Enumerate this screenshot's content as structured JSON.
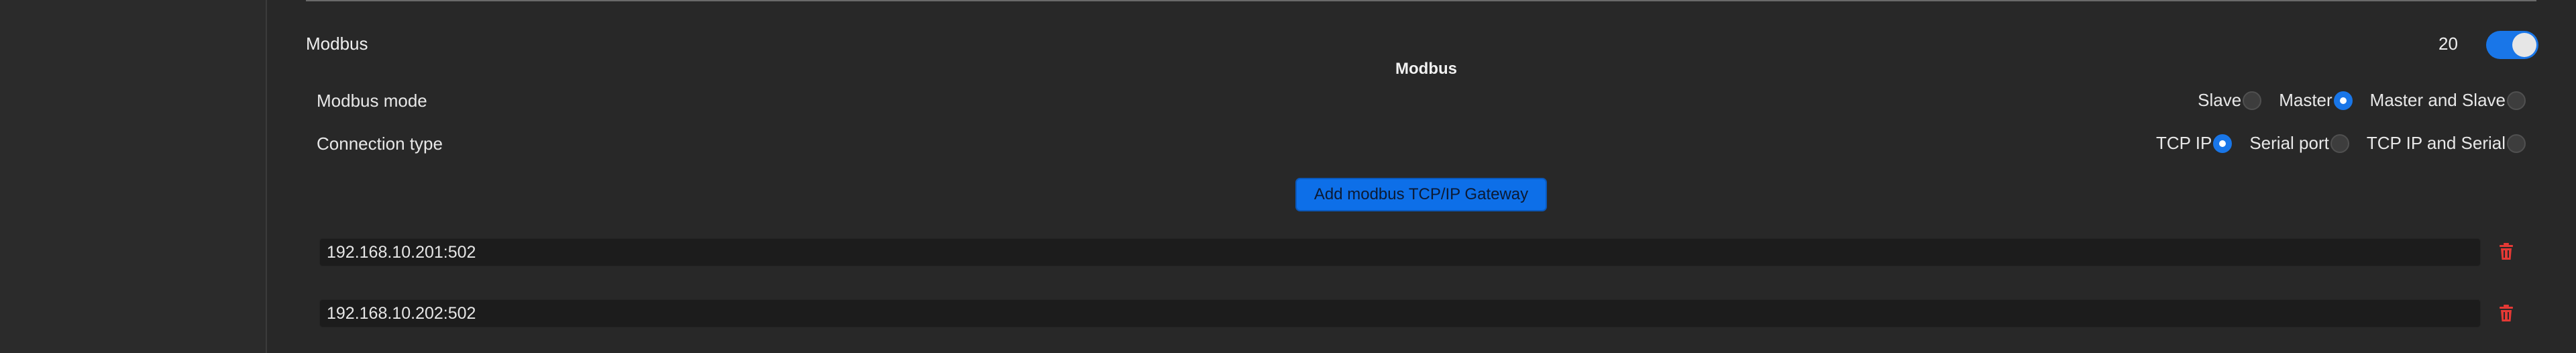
{
  "section": {
    "title": "Modbus",
    "count": "20",
    "enabled": true,
    "subheading": "Modbus"
  },
  "modbus_mode": {
    "label": "Modbus mode",
    "options": [
      "Slave",
      "Master",
      "Master and Slave"
    ],
    "selected": "Master"
  },
  "connection_type": {
    "label": "Connection type",
    "options": [
      "TCP IP",
      "Serial port",
      "TCP IP and Serial"
    ],
    "selected": "TCP IP"
  },
  "add_gateway_label": "Add modbus TCP/IP Gateway",
  "gateways": [
    {
      "value": "192.168.10.201:502"
    },
    {
      "value": "192.168.10.202:502"
    }
  ],
  "colors": {
    "accent": "#1976e8",
    "delete": "#e53935",
    "background": "#282828"
  },
  "icons": {
    "delete": "trash-icon"
  }
}
